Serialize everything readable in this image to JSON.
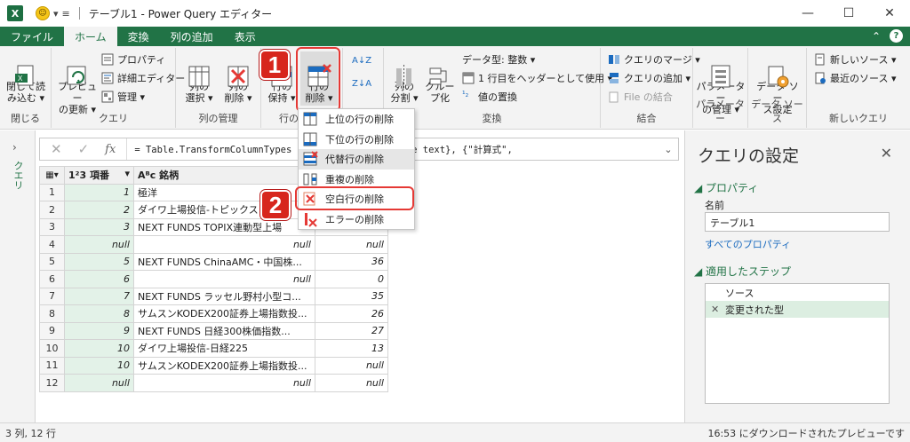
{
  "title_bar": {
    "app_logo": "X",
    "title": "テーブル1 - Power Query エディター",
    "min": "—",
    "max": "☐",
    "close": "✕"
  },
  "tabs": [
    {
      "label": "ファイル"
    },
    {
      "label": "ホーム"
    },
    {
      "label": "変換"
    },
    {
      "label": "列の追加"
    },
    {
      "label": "表示"
    }
  ],
  "ribbon": {
    "close_group": {
      "btn": "閉じて読\nみ込む ▾",
      "label": "閉じる"
    },
    "query_group": {
      "preview": "プレビュー\nの更新 ▾",
      "properties": "プロパティ",
      "advanced": "詳細エディター",
      "manage": "管理 ▾",
      "label": "クエリ"
    },
    "columns_group": {
      "select": "列の\n選択 ▾",
      "remove": "列の\n削除 ▾",
      "label": "列の管理"
    },
    "rows_group": {
      "keep": "行の\n保持 ▾",
      "remove": "行の\n削除 ▾",
      "label": "行の"
    },
    "sort": {
      "az": "A↓Z",
      "za": "Z↓A"
    },
    "transform_group": {
      "split": "列の\n分割 ▾",
      "group": "グルー\nプ化",
      "datatype": "データ型: 整数 ▾",
      "header": "1 行目をヘッダーとして使用 ▾",
      "replace": "値の置換",
      "label": "変換"
    },
    "combine_group": {
      "merge": "クエリのマージ ▾",
      "append": "クエリの追加 ▾",
      "file": "File の結合",
      "label": "結合"
    },
    "params_group": {
      "btn": "パラメーター\nの管理 ▾",
      "label": "パラメーター"
    },
    "ds_group": {
      "btn": "データ ソー\nス設定",
      "label": "データ ソース"
    },
    "newq_group": {
      "new": "新しいソース ▾",
      "recent": "最近のソース ▾",
      "label": "新しいクエリ"
    }
  },
  "badges": {
    "one": "1",
    "two": "2"
  },
  "menu": {
    "items": [
      {
        "label": "上位の行の削除"
      },
      {
        "label": "下位の行の削除"
      },
      {
        "label": "代替行の削除"
      },
      {
        "label": "重複の削除"
      },
      {
        "label": "空白行の削除"
      },
      {
        "label": "エラーの削除"
      }
    ]
  },
  "leftnav": {
    "chevron": "›",
    "label": "クエリ"
  },
  "formula": {
    "cancel": "✕",
    "confirm": "✓",
    "fx": "fx",
    "text": "= Table.TransformColumnTypes                4.Type}, {\"銘柄\", type text}, {\"計算式\",",
    "expand": "⌄"
  },
  "grid": {
    "corner": "▦▾",
    "headers": [
      "1²3 項番",
      "Aᴮc 銘柄",
      ""
    ],
    "rows": [
      {
        "n": "1",
        "num": "1",
        "name": "極洋",
        "val": ""
      },
      {
        "n": "2",
        "num": "2",
        "name": "ダイワ上場投信-トピックス",
        "val": ""
      },
      {
        "n": "3",
        "num": "3",
        "name": "NEXT FUNDS TOPIX連動型上場",
        "val": ""
      },
      {
        "n": "4",
        "num": "null",
        "name": "null",
        "val": "null"
      },
      {
        "n": "5",
        "num": "5",
        "name": "NEXT FUNDS ChinaAMC・中国株...",
        "val": "36"
      },
      {
        "n": "6",
        "num": "6",
        "name": "null",
        "val": "0"
      },
      {
        "n": "7",
        "num": "7",
        "name": "NEXT FUNDS ラッセル野村小型コ...",
        "val": "35"
      },
      {
        "n": "8",
        "num": "8",
        "name": "サムスンKODEX200証券上場指数投...",
        "val": "26"
      },
      {
        "n": "9",
        "num": "9",
        "name": "NEXT FUNDS 日経300株価指数...",
        "val": "27"
      },
      {
        "n": "10",
        "num": "10",
        "name": "ダイワ上場投信-日経225",
        "val": "13"
      },
      {
        "n": "11",
        "num": "10",
        "name": "サムスンKODEX200証券上場指数投...",
        "val": "null"
      },
      {
        "n": "12",
        "num": "null",
        "name": "null",
        "val": "null"
      }
    ]
  },
  "qpane": {
    "title": "クエリの設定",
    "close": "✕",
    "properties": "◢ プロパティ",
    "name_label": "名前",
    "name_value": "テーブル1",
    "all_props": "すべてのプロパティ",
    "steps_label": "◢ 適用したステップ",
    "steps": [
      {
        "icon": "",
        "label": "ソース"
      },
      {
        "icon": "✕",
        "label": "変更された型"
      }
    ]
  },
  "status": {
    "left": "3 列, 12 行",
    "right": "16:53 にダウンロードされたプレビューです"
  },
  "colors": {
    "accent": "#217346",
    "highlight": "#e53935",
    "badge": "#d7261d"
  }
}
